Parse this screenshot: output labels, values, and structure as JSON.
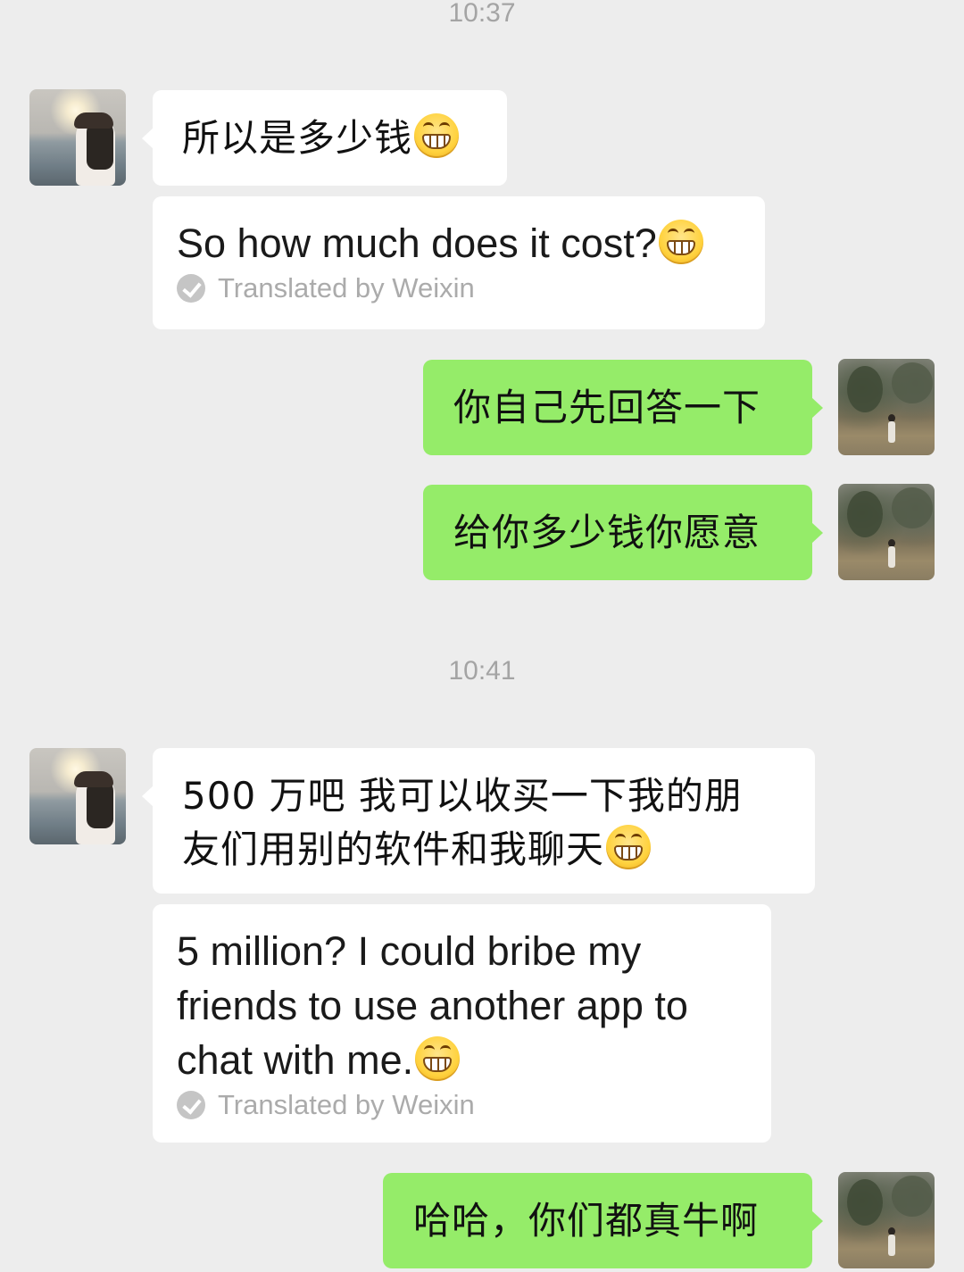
{
  "chat": {
    "timestamps": [
      "10:37",
      "10:41"
    ],
    "messages": [
      {
        "sender": "other",
        "text": "所以是多少钱",
        "emoji": "grinning-face-emoji"
      },
      {
        "sender": "other",
        "type": "translation",
        "text": "So how much does it cost?",
        "emoji": "grinning-face-emoji",
        "translated_label": "Translated by Weixin"
      },
      {
        "sender": "me",
        "text": "你自己先回答一下"
      },
      {
        "sender": "me",
        "text": "给你多少钱你愿意"
      },
      {
        "sender": "other",
        "line1": "500 万吧 我可以收买一下我的朋",
        "line2": "友们用别的软件和我聊天",
        "emoji": "grinning-face-emoji"
      },
      {
        "sender": "other",
        "type": "translation",
        "line1": "5 million? I could bribe my",
        "line2": "friends to use another app to",
        "line3": "chat with me.",
        "emoji": "grinning-face-emoji",
        "translated_label": "Translated by Weixin"
      },
      {
        "sender": "me",
        "text": "哈哈，你们都真牛啊"
      }
    ]
  },
  "colors": {
    "background": "#ededed",
    "bubble_other": "#ffffff",
    "bubble_me": "#95ec69",
    "timestamp_text": "#a4a4a4",
    "translated_text": "#ababab"
  }
}
